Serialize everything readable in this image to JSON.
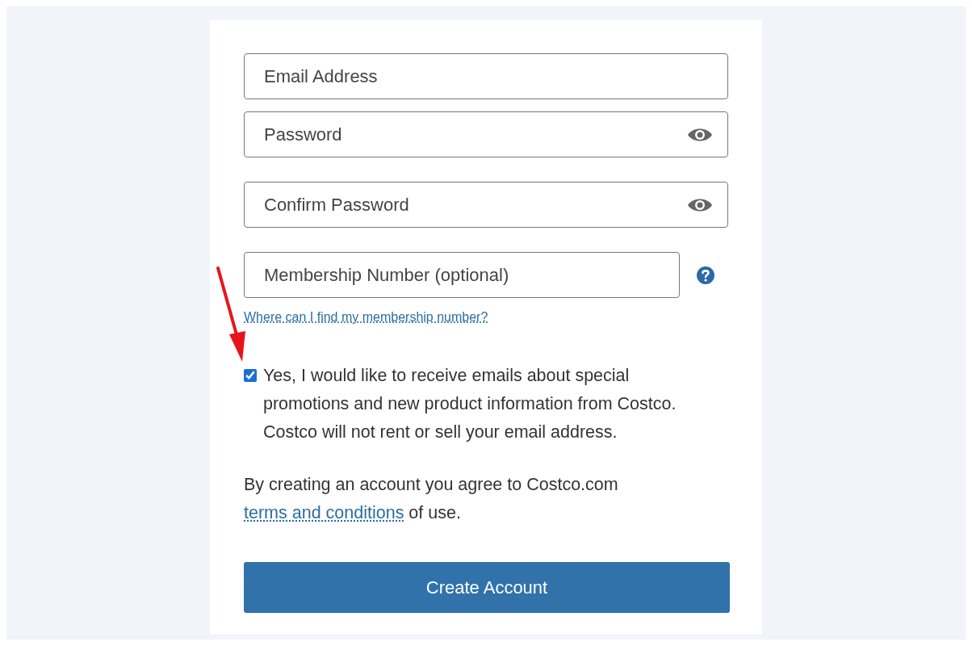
{
  "fields": [
    {
      "placeholder": "Email Address",
      "kind": "text"
    },
    {
      "placeholder": "Password",
      "kind": "password"
    },
    {
      "placeholder": "Confirm Password",
      "kind": "password"
    },
    {
      "placeholder": "Membership Number (optional)",
      "kind": "help"
    }
  ],
  "help_link": "Where can I find my membership number?",
  "newsletter": {
    "checked": true,
    "label": "Yes, I would like to receive emails about special promotions and new product information from Costco. Costco will not rent or sell your email address."
  },
  "terms": {
    "before": "By creating an account you agree to Costco.com",
    "link": "terms and conditions",
    "after": "of use."
  },
  "button": "Create Account",
  "annotations": [
    {
      "kind": "arrow"
    }
  ]
}
